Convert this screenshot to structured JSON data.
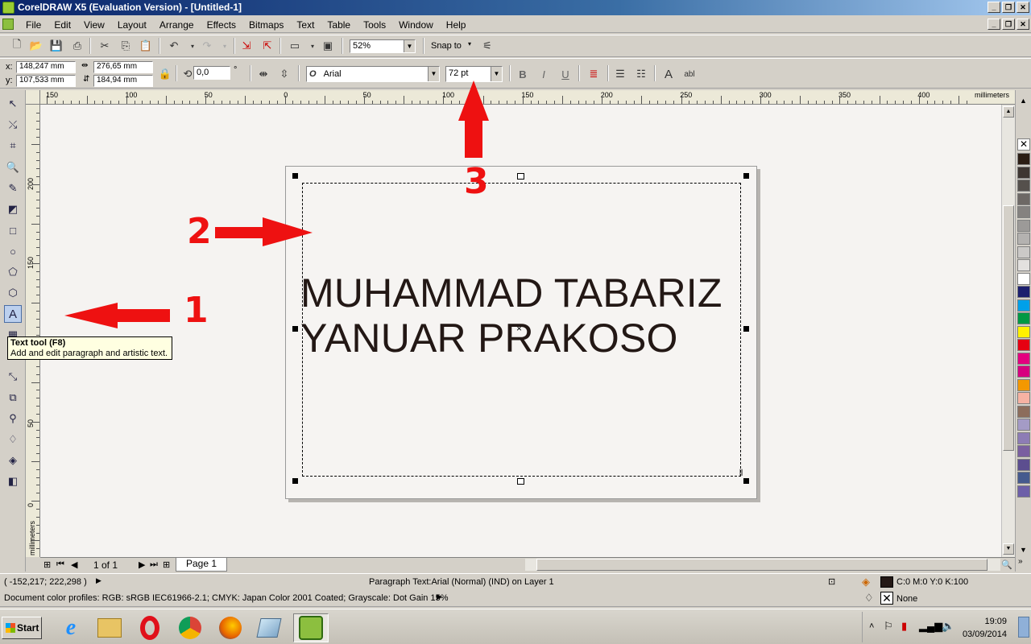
{
  "window": {
    "title": "CorelDRAW X5 (Evaluation Version) - [Untitled-1]"
  },
  "menu": [
    "File",
    "Edit",
    "View",
    "Layout",
    "Arrange",
    "Effects",
    "Bitmaps",
    "Text",
    "Table",
    "Tools",
    "Window",
    "Help"
  ],
  "standard_toolbar": {
    "zoom": "52%",
    "snap_to": "Snap to"
  },
  "property_bar": {
    "x": "148,247 mm",
    "y": "107,533 mm",
    "width": "276,65 mm",
    "height": "184,94 mm",
    "rotation": "0,0",
    "degree_symbol": "°",
    "font_name": "Arial",
    "font_size": "72 pt",
    "font_letter": "O",
    "abl": "abl"
  },
  "rulers": {
    "unit": "millimeters",
    "h_labels": [
      "150",
      "100",
      "50",
      "0",
      "50",
      "100",
      "150",
      "200",
      "250",
      "300",
      "350",
      "400"
    ],
    "v_labels": [
      "200",
      "150",
      "100",
      "50",
      "0"
    ]
  },
  "document": {
    "text_line1": "MUHAMMAD TABARIZ",
    "text_line2": "YANUAR PRAKOSO"
  },
  "annotations": {
    "n1": "1",
    "n2": "2",
    "n3": "3",
    "color": "#ee1111"
  },
  "tooltip": {
    "title": "Text tool (F8)",
    "body": "Add and edit paragraph and artistic text."
  },
  "page_nav": {
    "count": "1 of 1",
    "tab": "Page 1"
  },
  "status": {
    "coords": "( -152,217; 222,298 )",
    "selection": "Paragraph Text:Arial (Normal) (IND) on Layer 1",
    "profiles": "Document color profiles: RGB: sRGB IEC61966-2.1; CMYK: Japan Color 2001 Coated; Grayscale: Dot Gain 15%",
    "fill": "C:0 M:0 Y:0 K:100",
    "outline": "None"
  },
  "taskbar": {
    "start": "Start",
    "time": "19:09",
    "date": "03/09/2014"
  },
  "palette_colors": [
    "#2b1d14",
    "#3e3632",
    "#55504c",
    "#6d6865",
    "#858280",
    "#9c9a98",
    "#b4b2b0",
    "#cbc9c7",
    "#e3e1df",
    "#ffffff",
    "#1c1f6e",
    "#00a0e9",
    "#009944",
    "#fff100",
    "#e60012",
    "#e4007f",
    "#d7007f",
    "#f39800",
    "#f6b2a3",
    "#8c6d5c",
    "#a49bc6",
    "#8d7cb5",
    "#7a5fa0",
    "#5c4e8f",
    "#455a8e",
    "#6d5fa8"
  ]
}
